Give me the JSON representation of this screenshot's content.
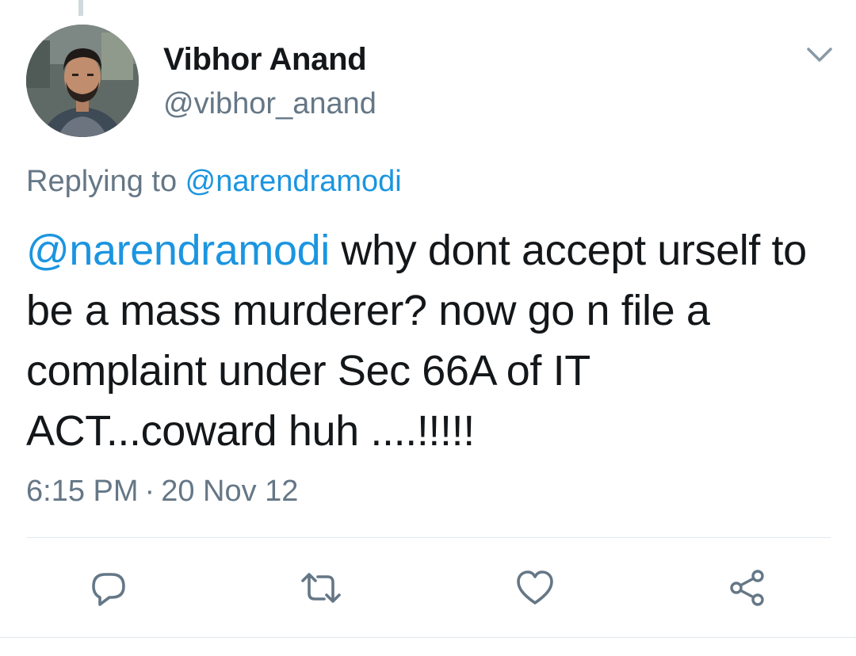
{
  "author": {
    "display_name": "Vibhor Anand",
    "handle": "@vibhor_anand"
  },
  "reply_context": {
    "prefix": "Replying to ",
    "mention": "@narendramodi"
  },
  "tweet": {
    "mention": "@narendramodi",
    "body": " why dont accept urself to be a mass murderer? now go n file a complaint under Sec 66A of IT ACT...coward huh ....!!!!!"
  },
  "meta": {
    "time": "6:15 PM",
    "separator": "·",
    "date": "20 Nov 12"
  },
  "actions": {
    "reply_icon": "reply-icon",
    "retweet_icon": "retweet-icon",
    "like_icon": "heart-icon",
    "share_icon": "share-icon"
  },
  "colors": {
    "link": "#1b95e0",
    "secondary_text": "#657786",
    "primary_text": "#14171a",
    "icon": "#657786",
    "divider": "#e1e8ed"
  }
}
